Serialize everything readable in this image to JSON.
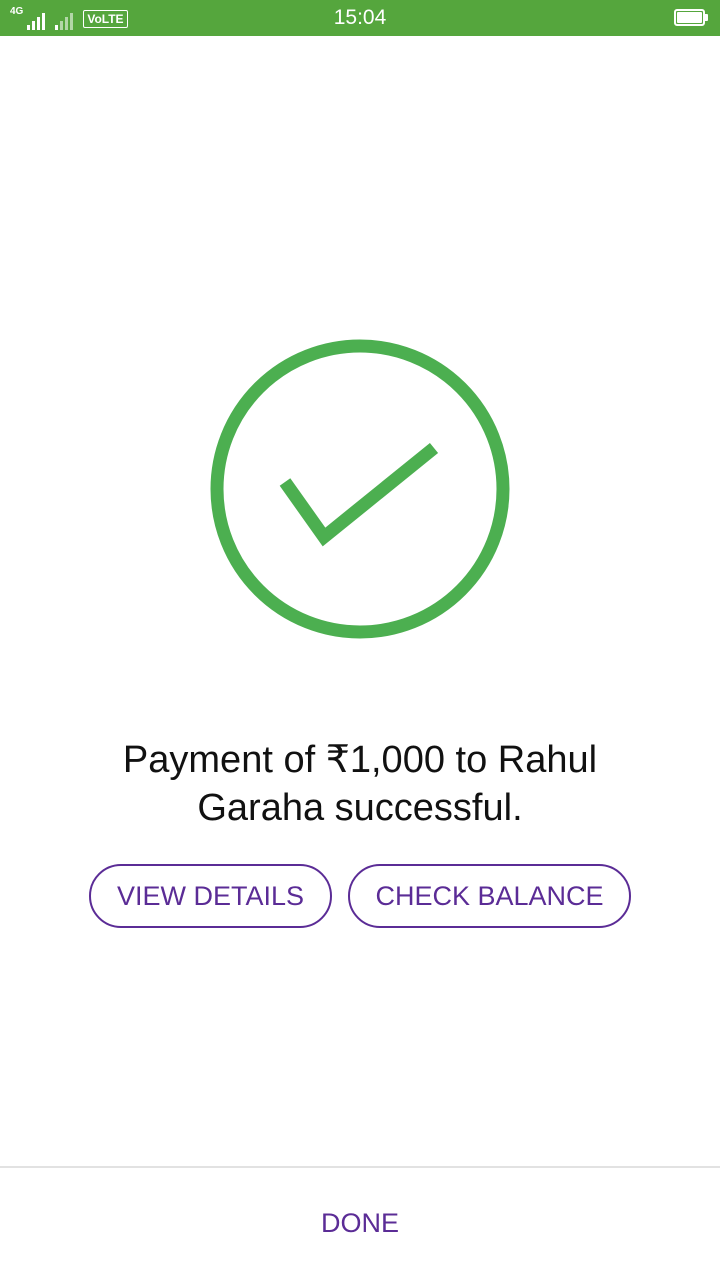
{
  "status_bar": {
    "network_label_1": "4G",
    "volte": "VoLTE",
    "time": "15:04",
    "icons": [
      "signal-icon",
      "signal-weak-icon",
      "volte-icon",
      "battery-icon"
    ],
    "color": "#55a63d"
  },
  "success": {
    "icon": "check-circle-icon",
    "color": "#4caf50",
    "message": "Payment of ₹1,000 to Rahul Garaha successful."
  },
  "actions": {
    "view_details": "VIEW DETAILS",
    "check_balance": "CHECK BALANCE",
    "accent_color": "#5b2c96"
  },
  "footer": {
    "done": "DONE"
  }
}
